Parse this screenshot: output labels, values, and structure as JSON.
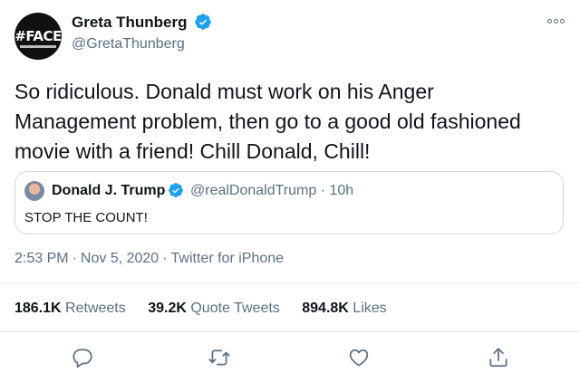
{
  "author": {
    "name": "Greta Thunberg",
    "handle": "@GretaThunberg",
    "avatar_text": "#FACE",
    "verified_icon": "verified-badge-icon"
  },
  "tweet": {
    "text": "So ridiculous. Donald must work on his Anger Management problem, then go to a good old fashioned movie with a friend! Chill Donald, Chill!"
  },
  "quoted": {
    "name": "Donald J. Trump",
    "handle": "@realDonaldTrump",
    "time": "· 10h",
    "text": "STOP THE COUNT!"
  },
  "meta": {
    "time": "2:53 PM",
    "date": "Nov 5, 2020",
    "source": "Twitter for iPhone"
  },
  "stats": {
    "retweets_count": "186.1K",
    "retweets_label": "Retweets",
    "quotes_count": "39.2K",
    "quotes_label": "Quote Tweets",
    "likes_count": "894.8K",
    "likes_label": "Likes"
  },
  "actions": [
    "reply-icon",
    "retweet-icon",
    "like-icon",
    "share-icon"
  ],
  "colors": {
    "accent": "#1da1f2",
    "muted": "#5b7083",
    "border": "#cfd9de"
  }
}
